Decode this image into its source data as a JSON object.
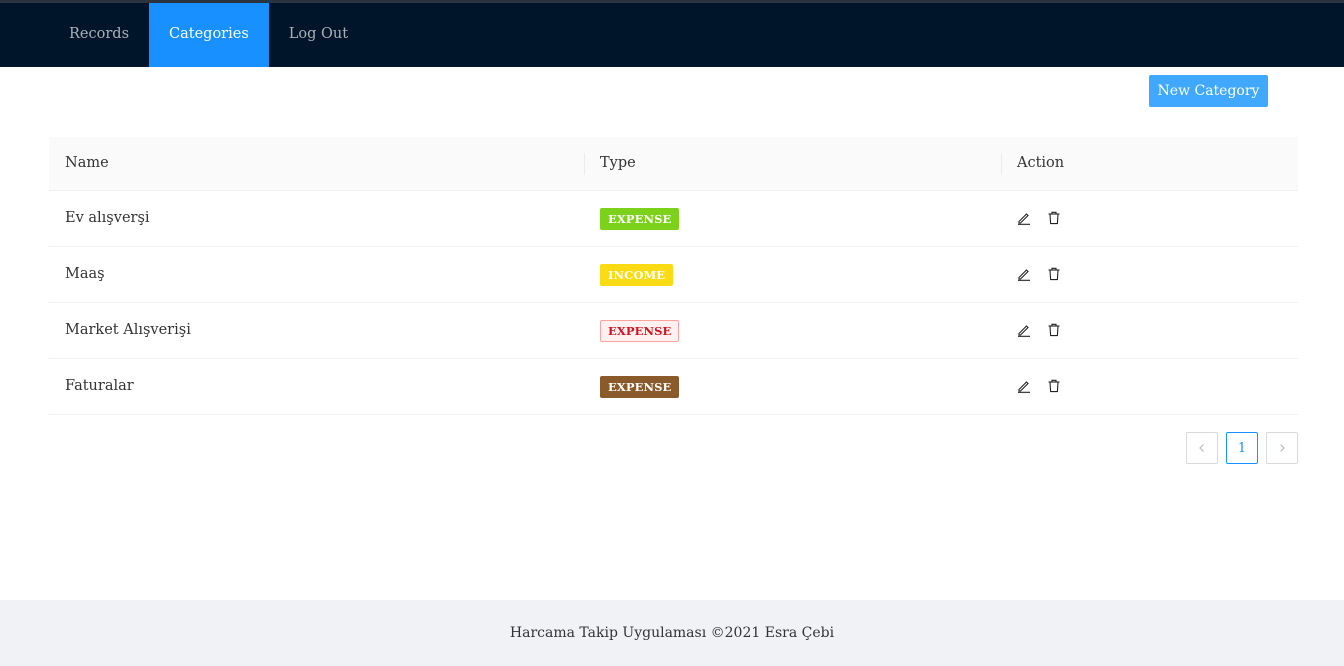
{
  "nav": {
    "items": [
      {
        "label": "Records",
        "active": false
      },
      {
        "label": "Categories",
        "active": true
      },
      {
        "label": "Log Out",
        "active": false
      }
    ]
  },
  "toolbar": {
    "new_category_label": "New Category"
  },
  "table": {
    "columns": [
      "Name",
      "Type",
      "Action"
    ],
    "rows": [
      {
        "name": "Ev alışverşi",
        "type": "EXPENSE",
        "tag_bg": "#7cd21a",
        "tag_fg": "#ffffff",
        "tag_border": "#7cd21a"
      },
      {
        "name": "Maaş",
        "type": "INCOME",
        "tag_bg": "#fadb14",
        "tag_fg": "#ffffff",
        "tag_border": "#fadb14"
      },
      {
        "name": "Market Alışverişi",
        "type": "EXPENSE",
        "tag_bg": "#fff1f0",
        "tag_fg": "#cf1322",
        "tag_border": "#ffa39e"
      },
      {
        "name": "Faturalar",
        "type": "EXPENSE",
        "tag_bg": "#8b5a2b",
        "tag_fg": "#ffffff",
        "tag_border": "#8b5a2b"
      }
    ]
  },
  "pagination": {
    "prev_icon": "chevron-left-icon",
    "current_page": "1",
    "next_icon": "chevron-right-icon"
  },
  "footer": {
    "text": "Harcama Takip Uygulaması ©2021 Esra Çebi"
  },
  "colors": {
    "header_bg": "#001529",
    "accent": "#1890ff",
    "button": "#40a9ff"
  }
}
